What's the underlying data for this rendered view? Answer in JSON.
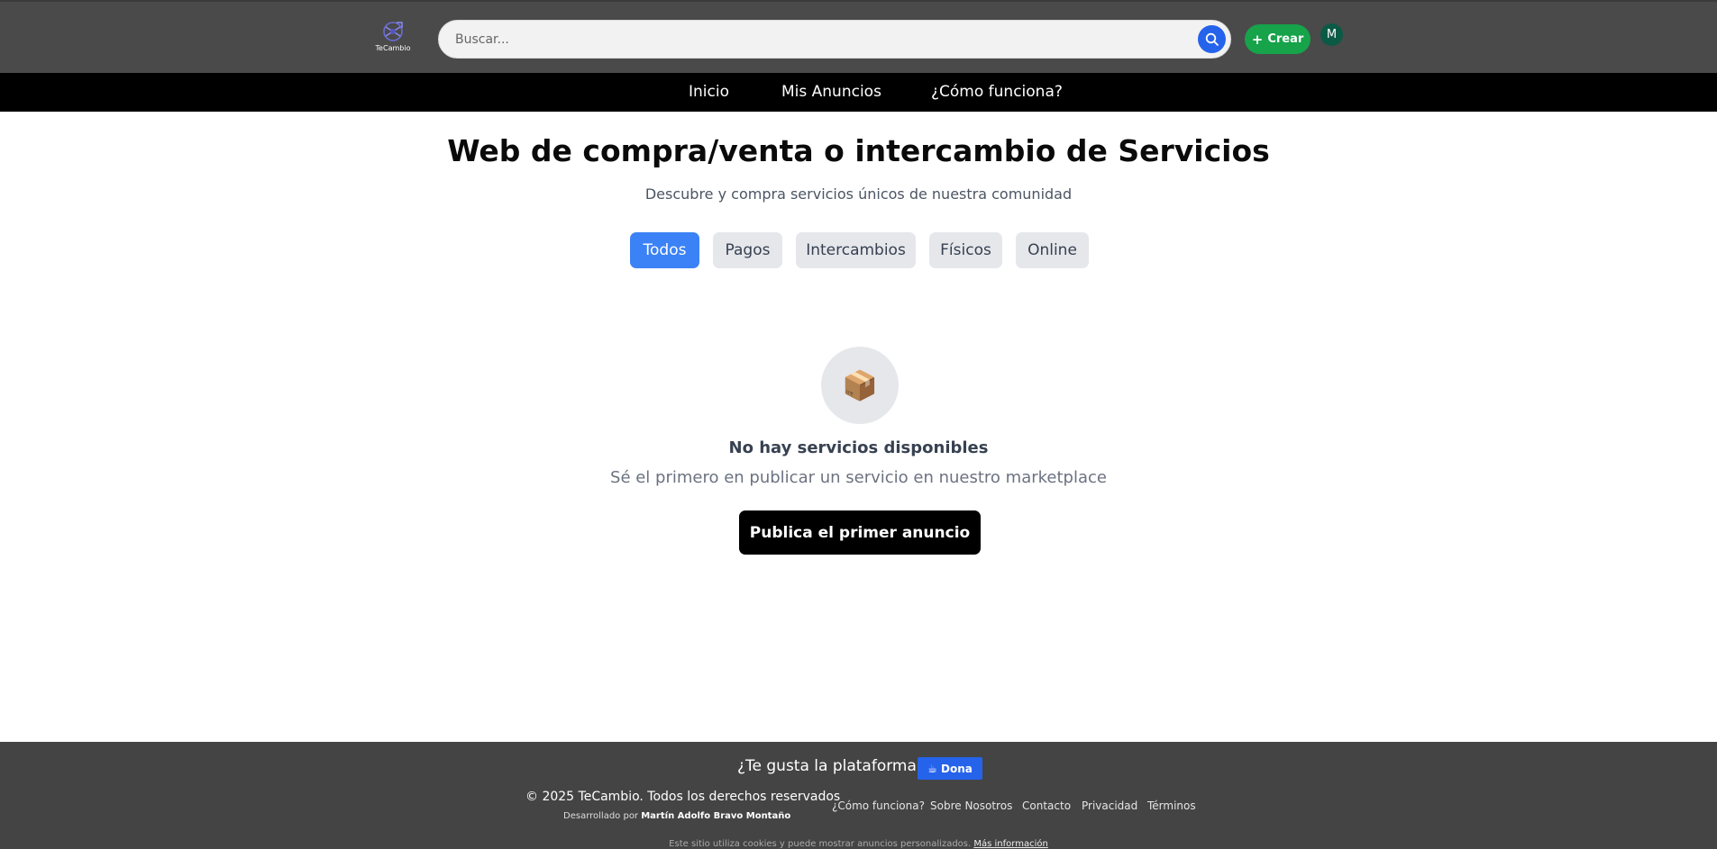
{
  "header": {
    "logo_text": "TeCambio",
    "search_placeholder": "Buscar...",
    "create_label": "Crear",
    "avatar_initial": "M"
  },
  "nav": {
    "items": [
      {
        "label": "Inicio"
      },
      {
        "label": "Mis Anuncios"
      },
      {
        "label": "¿Cómo funciona?"
      }
    ]
  },
  "main": {
    "title": "Web de compra/venta o intercambio de Servicios",
    "subtitle": "Descubre y compra servicios únicos de nuestra comunidad",
    "filters": [
      {
        "label": "Todos"
      },
      {
        "label": "Pagos"
      },
      {
        "label": "Intercambios"
      },
      {
        "label": "Físicos"
      },
      {
        "label": "Online"
      }
    ],
    "active_filter": "Todos",
    "empty": {
      "icon": "package-icon",
      "icon_glyph": "📦",
      "title": "No hay servicios disponibles",
      "subtitle": "Sé el primero en publicar un servicio en nuestro marketplace",
      "button_label": "Publica el primer anuncio"
    }
  },
  "footer": {
    "like_text": "¿Te gusta la plataforma?",
    "dona_label": "☕ Dona",
    "copyright": "© 2025 TeCambio. Todos los derechos reservados",
    "developed_by": "Desarrollado por",
    "developer": "Martín Adolfo Bravo Montaño",
    "links": [
      {
        "label": "¿Cómo funciona?"
      },
      {
        "label": "Sobre Nosotros"
      },
      {
        "label": "Contacto"
      },
      {
        "label": "Privacidad"
      },
      {
        "label": "Términos"
      }
    ],
    "cookie_text": "Este sitio utiliza cookies y puede mostrar anuncios personalizados.",
    "cookie_more": "Más información"
  },
  "colors": {
    "header_bg": "#4a4a4a",
    "nav_bg": "#000000",
    "accent_blue": "#3b82f6",
    "create_green": "#16a34a",
    "avatar_green": "#0b5a45",
    "footer_bg": "#444444"
  }
}
